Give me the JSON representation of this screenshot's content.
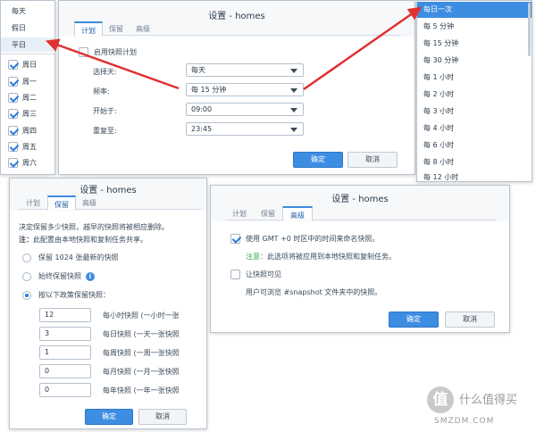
{
  "left_menu": {
    "items": [
      "每天",
      "假日",
      "平日"
    ],
    "days": [
      "周日",
      "周一",
      "周二",
      "周三",
      "周四",
      "周五",
      "周六"
    ]
  },
  "schedule_dialog": {
    "title": "设置 - homes",
    "tabs": [
      "计划",
      "保留",
      "高级"
    ],
    "enable_label": "启用快照计划",
    "fields": [
      {
        "label": "选择天:",
        "value": "每天"
      },
      {
        "label": "频率:",
        "value": "每 15 分钟"
      },
      {
        "label": "开始于:",
        "value": "09:00"
      },
      {
        "label": "重复至:",
        "value": "23:45"
      }
    ],
    "ok": "确定",
    "cancel": "取消"
  },
  "frequency_dropdown": {
    "items": [
      "每日一次",
      "每 5 分钟",
      "每 15 分钟",
      "每 30 分钟",
      "每 1 小时",
      "每 2 小时",
      "每 3 小时",
      "每 4 小时",
      "每 6 小时",
      "每 8 小时",
      "每 12 小时"
    ],
    "selected_index": 0
  },
  "retention_dialog": {
    "title": "设置 - homes",
    "tabs": [
      "计划",
      "保留",
      "高级"
    ],
    "desc": "决定保留多少快照，越早的快照将被相应删除。",
    "note_label": "注：",
    "note_text": "此配置由本地快照和复制任务共享。",
    "options": [
      "保留 1024 张最新的快照",
      "始终保留快照",
      "按以下政策保留快照："
    ],
    "selected_option": 2,
    "policies": [
      {
        "value": "12",
        "label": "每小时快照 (一小时一张"
      },
      {
        "value": "3",
        "label": "每日快照 (一天一张快照"
      },
      {
        "value": "1",
        "label": "每周快照 (一周一张快照"
      },
      {
        "value": "0",
        "label": "每月快照 (一月一张快照"
      },
      {
        "value": "0",
        "label": "每年快照 (一年一张快照"
      }
    ],
    "ok": "确定",
    "cancel": "取消"
  },
  "advanced_dialog": {
    "title": "设置 - homes",
    "tabs": [
      "计划",
      "保留",
      "高级"
    ],
    "gmt_label": "使用 GMT +0 时区中的时间来命名快照。",
    "attention_label": "注意：",
    "attention_text": "此选项将被应用到本地快照和复制任务。",
    "visible_label": "让快照可见",
    "visible_desc": "用户可浏览 #snapshot 文件夹中的快照。",
    "ok": "确定",
    "cancel": "取消"
  },
  "watermark": {
    "text": "什么值得买",
    "sub": "SMZDM.COM"
  },
  "colors": {
    "accent": "#3d8de2",
    "arrow": "#e03030"
  }
}
